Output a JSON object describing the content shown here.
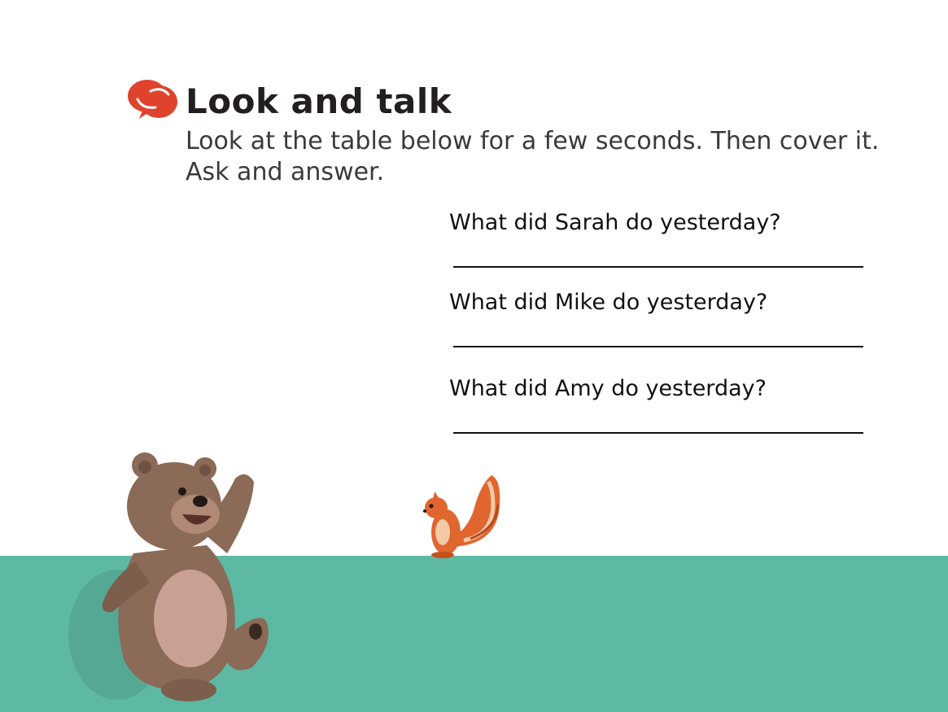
{
  "heading": {
    "title": "Look and talk",
    "instructions": "Look at the table below for a few seconds. Then cover it. Ask and answer.",
    "icon": "speech-bubbles-icon",
    "icon_color": "#e0432d"
  },
  "questions": [
    {
      "text": "What did Sarah do yesterday?",
      "answer": ""
    },
    {
      "text": "What did Mike do yesterday?",
      "answer": ""
    },
    {
      "text": "What did Amy do yesterday?",
      "answer": ""
    }
  ],
  "colors": {
    "ground": "#5db9a3",
    "bear_fur": "#8b6a57",
    "bear_belly": "#c9a194",
    "squirrel": "#e0652f"
  }
}
